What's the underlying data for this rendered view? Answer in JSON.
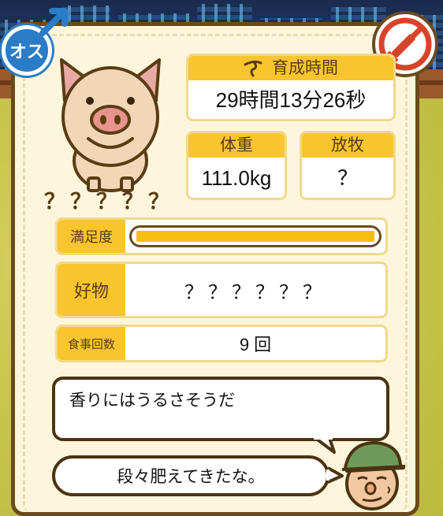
{
  "gender": {
    "label": "オス"
  },
  "pig": {
    "name": "？？？？？"
  },
  "raise_time": {
    "label": "育成時間",
    "value": "29時間13分26秒"
  },
  "weight": {
    "label": "体重",
    "value": "111.0kg"
  },
  "grazing": {
    "label": "放牧",
    "value": "？"
  },
  "satisfaction": {
    "label": "満足度",
    "level": 1.0
  },
  "favorite": {
    "label": "好物",
    "value": "？？？？？？"
  },
  "meals": {
    "label": "食事回数",
    "value": "9 回"
  },
  "pig_thought": "香りにはうるさそうだ",
  "farmer_comment": "段々肥えてきたな。",
  "colors": {
    "accent": "#f8c52e",
    "male_blue": "#2a7cc7",
    "no_medicine_red": "#d8442a",
    "frame_brown": "#6b4a1e"
  }
}
